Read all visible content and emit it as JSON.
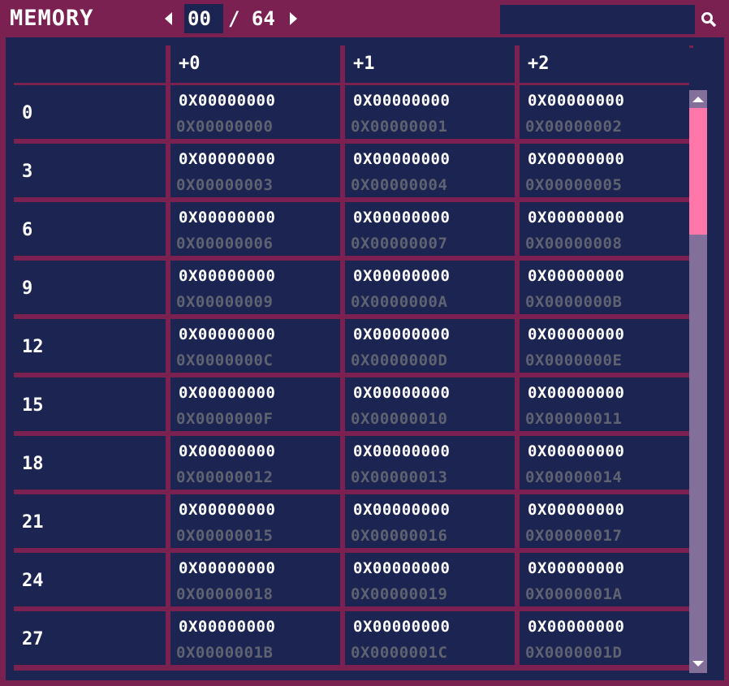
{
  "header": {
    "title": "MEMORY",
    "page_current": "00",
    "page_separator": "/",
    "page_total": "64",
    "search_value": ""
  },
  "table": {
    "columns": [
      "",
      "+0",
      "+1",
      "+2"
    ],
    "rows": [
      {
        "label": "0",
        "cells": [
          {
            "value": "0X00000000",
            "address": "0X00000000"
          },
          {
            "value": "0X00000000",
            "address": "0X00000001"
          },
          {
            "value": "0X00000000",
            "address": "0X00000002"
          }
        ]
      },
      {
        "label": "3",
        "cells": [
          {
            "value": "0X00000000",
            "address": "0X00000003"
          },
          {
            "value": "0X00000000",
            "address": "0X00000004"
          },
          {
            "value": "0X00000000",
            "address": "0X00000005"
          }
        ]
      },
      {
        "label": "6",
        "cells": [
          {
            "value": "0X00000000",
            "address": "0X00000006"
          },
          {
            "value": "0X00000000",
            "address": "0X00000007"
          },
          {
            "value": "0X00000000",
            "address": "0X00000008"
          }
        ]
      },
      {
        "label": "9",
        "cells": [
          {
            "value": "0X00000000",
            "address": "0X00000009"
          },
          {
            "value": "0X00000000",
            "address": "0X0000000A"
          },
          {
            "value": "0X00000000",
            "address": "0X0000000B"
          }
        ]
      },
      {
        "label": "12",
        "cells": [
          {
            "value": "0X00000000",
            "address": "0X0000000C"
          },
          {
            "value": "0X00000000",
            "address": "0X0000000D"
          },
          {
            "value": "0X00000000",
            "address": "0X0000000E"
          }
        ]
      },
      {
        "label": "15",
        "cells": [
          {
            "value": "0X00000000",
            "address": "0X0000000F"
          },
          {
            "value": "0X00000000",
            "address": "0X00000010"
          },
          {
            "value": "0X00000000",
            "address": "0X00000011"
          }
        ]
      },
      {
        "label": "18",
        "cells": [
          {
            "value": "0X00000000",
            "address": "0X00000012"
          },
          {
            "value": "0X00000000",
            "address": "0X00000013"
          },
          {
            "value": "0X00000000",
            "address": "0X00000014"
          }
        ]
      },
      {
        "label": "21",
        "cells": [
          {
            "value": "0X00000000",
            "address": "0X00000015"
          },
          {
            "value": "0X00000000",
            "address": "0X00000016"
          },
          {
            "value": "0X00000000",
            "address": "0X00000017"
          }
        ]
      },
      {
        "label": "24",
        "cells": [
          {
            "value": "0X00000000",
            "address": "0X00000018"
          },
          {
            "value": "0X00000000",
            "address": "0X00000019"
          },
          {
            "value": "0X00000000",
            "address": "0X0000001A"
          }
        ]
      },
      {
        "label": "27",
        "cells": [
          {
            "value": "0X00000000",
            "address": "0X0000001B"
          },
          {
            "value": "0X00000000",
            "address": "0X0000001C"
          },
          {
            "value": "0X00000000",
            "address": "0X0000001D"
          }
        ]
      }
    ]
  },
  "scrollbar": {
    "position_fraction": 0.0,
    "visible_fraction": 0.22
  },
  "colors": {
    "frame": "#7a2152",
    "cell_bg": "#1c2552",
    "text": "#ffffff",
    "address_text": "#5e6271",
    "scroll_thumb": "#ff77a8",
    "scroll_rail": "#82709b"
  },
  "icons": {
    "prev_page": "left-triangle-arrow",
    "next_page": "right-triangle-arrow",
    "search": "magnifier-icon",
    "scroll_up": "up-triangle-arrow",
    "scroll_down": "down-triangle-arrow"
  }
}
